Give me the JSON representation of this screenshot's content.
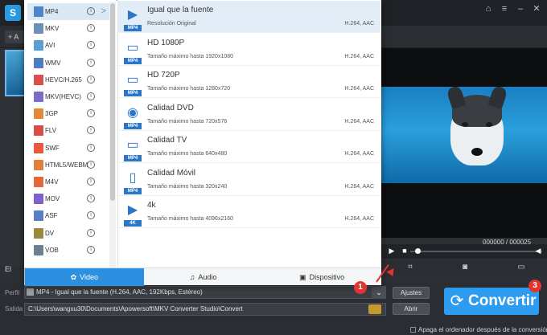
{
  "app": {
    "logo_text": "S",
    "add_button": "+ A",
    "side_label": "El",
    "time": "000000 / 000025"
  },
  "format_list": [
    {
      "label": "MP4",
      "color": "#4a86c8",
      "selected": true,
      "chevron": ">"
    },
    {
      "label": "MKV",
      "color": "#6c8fb5"
    },
    {
      "label": "AVI",
      "color": "#5a9ed6"
    },
    {
      "label": "WMV",
      "color": "#4a7ec0"
    },
    {
      "label": "HEVC/H.265",
      "color": "#d84f4f"
    },
    {
      "label": "MKV(HEVC)",
      "color": "#7d6cc7"
    },
    {
      "label": "3GP",
      "color": "#e08a3c"
    },
    {
      "label": "FLV",
      "color": "#d94c4c"
    },
    {
      "label": "SWF",
      "color": "#e8583c"
    },
    {
      "label": "HTML5/WEBM",
      "color": "#e0813a"
    },
    {
      "label": "M4V",
      "color": "#e06b3a"
    },
    {
      "label": "MOV",
      "color": "#7b61c9"
    },
    {
      "label": "ASF",
      "color": "#5a7fc2"
    },
    {
      "label": "DV",
      "color": "#9a8a3c"
    },
    {
      "label": "VOB",
      "color": "#6f7f93"
    }
  ],
  "info_glyph": "i",
  "presets": [
    {
      "title": "Igual que la fuente",
      "sub": "Resolución Original",
      "codec": "H.264, AAC",
      "icon": "▶",
      "tag": "MP4",
      "selected": true
    },
    {
      "title": "HD 1080P",
      "sub": "Tamaño máximo hasta 1920x1080",
      "codec": "H.264, AAC",
      "icon": "▭",
      "tag": "MP4"
    },
    {
      "title": "HD 720P",
      "sub": "Tamaño máximo hasta 1280x720",
      "codec": "H.264, AAC",
      "icon": "▭",
      "tag": "MP4"
    },
    {
      "title": "Calidad DVD",
      "sub": "Tamaño máximo hasta 720x576",
      "codec": "H.264, AAC",
      "icon": "◉",
      "tag": "MP4"
    },
    {
      "title": "Calidad TV",
      "sub": "Tamaño máximo hasta 640x480",
      "codec": "H.264, AAC",
      "icon": "▭",
      "tag": "MP4"
    },
    {
      "title": "Calidad Móvil",
      "sub": "Tamaño máximo hasta 320x240",
      "codec": "H.264, AAC",
      "icon": "▯",
      "tag": "MP4"
    },
    {
      "title": "4k",
      "sub": "Tamaño máximo hasta 4096x2160",
      "codec": "H.264, AAC",
      "icon": "▶",
      "tag": "4K"
    }
  ],
  "tabs": [
    {
      "label": "Video",
      "icon": "✿",
      "active": true
    },
    {
      "label": "Audio",
      "icon": "♫",
      "active": false
    },
    {
      "label": "Dispositivo",
      "icon": "▣",
      "active": false
    }
  ],
  "bottom": {
    "perfil_label": "Perfil",
    "perfil_value": "MP4 - Igual que la fuente (H.264, AAC, 192Kbps, Estéreo)",
    "salida_label": "Salida",
    "salida_value": "C:\\Users\\wangxu30\\Documents\\Apowersoft\\MKV Converter Studio\\Convert",
    "ajustes": "Ajustes",
    "abrir": "Abrir",
    "convert": "Convertir",
    "apaga": "Apaga el ordenador después de la conversión"
  },
  "callouts": [
    "1",
    "2",
    "3"
  ],
  "colors": {
    "accent": "#2d9cf0",
    "callout": "#e3342f"
  }
}
